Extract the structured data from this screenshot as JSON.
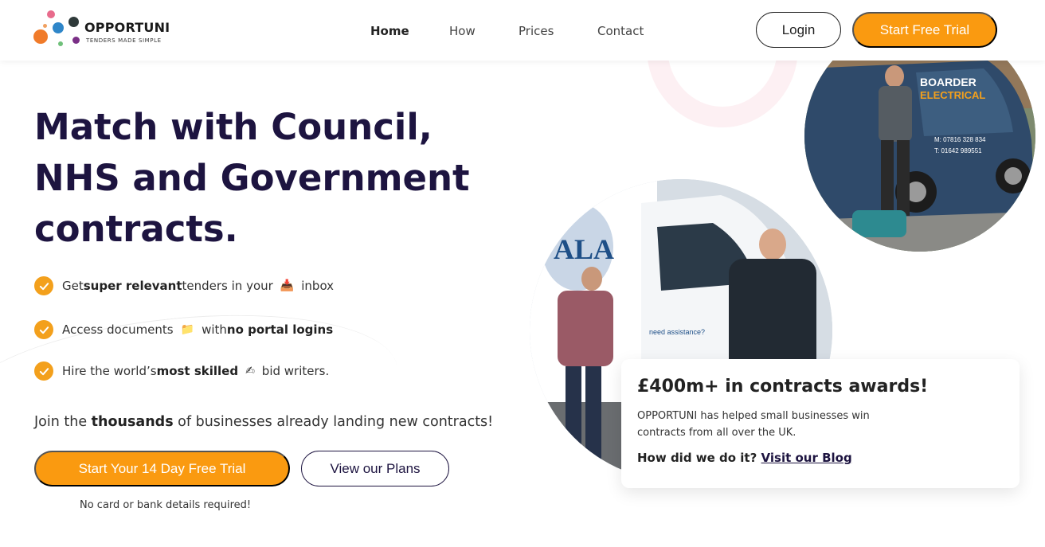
{
  "brand": {
    "name": "OPPORTUNI",
    "tagline": "TENDERS MADE SIMPLE",
    "colors": {
      "accent": "#fa9a10",
      "navy": "#1d1440",
      "dot_orange": "#f07b2a",
      "dot_blue": "#2f86c9",
      "dot_pink": "#e86b8c",
      "dot_dark": "#2f3a3a",
      "dot_green": "#6fc07a",
      "dot_purple": "#7a2f86"
    }
  },
  "nav": {
    "items": [
      {
        "label": "Home",
        "active": true
      },
      {
        "label": "How",
        "active": false
      },
      {
        "label": "Prices",
        "active": false
      },
      {
        "label": "Contact",
        "active": false
      }
    ],
    "login_label": "Login",
    "trial_label": "Start Free Trial"
  },
  "hero": {
    "title_lines": [
      "Match with Council,",
      "NHS and Government",
      "contracts."
    ],
    "features": [
      {
        "pre": "Get ",
        "bold": "super relevant",
        "post": " tenders in your",
        "emoji": "📥",
        "after": "inbox",
        "icon": "inbox-icon"
      },
      {
        "pre": "Access documents",
        "emoji": "📁",
        "mid": "with ",
        "bold": "no portal logins",
        "icon": "folder-icon"
      },
      {
        "pre": "Hire the world’s ",
        "bold": "most skilled",
        "emoji": "✍",
        "after": "bid writers.",
        "icon": "writing-hand-icon"
      }
    ],
    "join_pre": "Join the ",
    "join_bold": "thousands",
    "join_post": " of businesses already landing new contracts!",
    "cta_primary": "Start Your 14 Day Free Trial",
    "cta_secondary": "View our Plans",
    "note": "No card or bank details required!"
  },
  "card": {
    "title": "£400m+ in contracts awards!",
    "text": "OPPORTUNI has helped small businesses win contracts from all over the UK.",
    "question": "How did we do it?",
    "link": "Visit our Blog"
  },
  "photos": {
    "van_top": {
      "brand_text": "BOARDER ELECTRICAL",
      "phone_m": "M: 07816 328 834",
      "phone_t": "T: 01642 989551"
    },
    "van_bottom": {
      "brand_text": "ALA",
      "side_text": "need assistance?"
    }
  }
}
